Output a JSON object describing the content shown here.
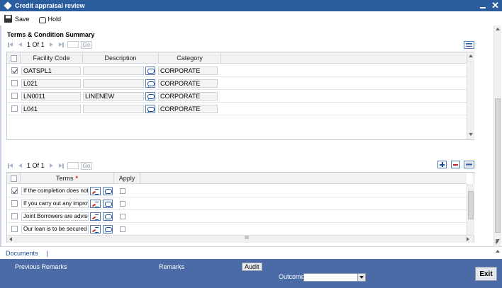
{
  "window": {
    "title": "Credit appraisal review"
  },
  "toolbar": {
    "save_label": "Save",
    "hold_label": "Hold"
  },
  "section": {
    "title": "Terms & Condition Summary"
  },
  "facility_pager": {
    "page": "1",
    "of_label": "Of",
    "total": "1",
    "go_label": "Go"
  },
  "facility_grid": {
    "headers": [
      "Facility Code",
      "Description",
      "Category"
    ],
    "rows": [
      {
        "checked": true,
        "code": "OATSPL1",
        "description": "",
        "category": "CORPORATE"
      },
      {
        "checked": false,
        "code": "L021",
        "description": "",
        "category": "CORPORATE"
      },
      {
        "checked": false,
        "code": "LN0011",
        "description": "LINENEW",
        "category": "CORPORATE"
      },
      {
        "checked": false,
        "code": "L041",
        "description": "",
        "category": "CORPORATE"
      }
    ]
  },
  "terms_pager": {
    "page": "1",
    "of_label": "Of",
    "total": "1",
    "go_label": "Go"
  },
  "terms_grid": {
    "headers": {
      "terms": "Terms",
      "required": "*",
      "apply": "Apply"
    },
    "rows": [
      {
        "checked": true,
        "text": "If the completion does not",
        "apply": false
      },
      {
        "checked": false,
        "text": "If you carry out any improve",
        "apply": false
      },
      {
        "checked": false,
        "text": "Joint Borrowers are advise",
        "apply": false
      },
      {
        "checked": false,
        "text": "Our loan is to be secured",
        "apply": false
      }
    ],
    "hscroll_grip": "III"
  },
  "documents": {
    "label": "Documents",
    "separator": "|"
  },
  "footer": {
    "previous_remarks": "Previous Remarks",
    "remarks": "Remarks",
    "audit": "Audit",
    "outcome_label": "Outcome",
    "outcome_value": "",
    "exit": "Exit"
  },
  "colors": {
    "titlebar": "#2b5c9e",
    "footer": "#4a6ba5",
    "link": "#1b4f9c",
    "required": "#e02020"
  }
}
